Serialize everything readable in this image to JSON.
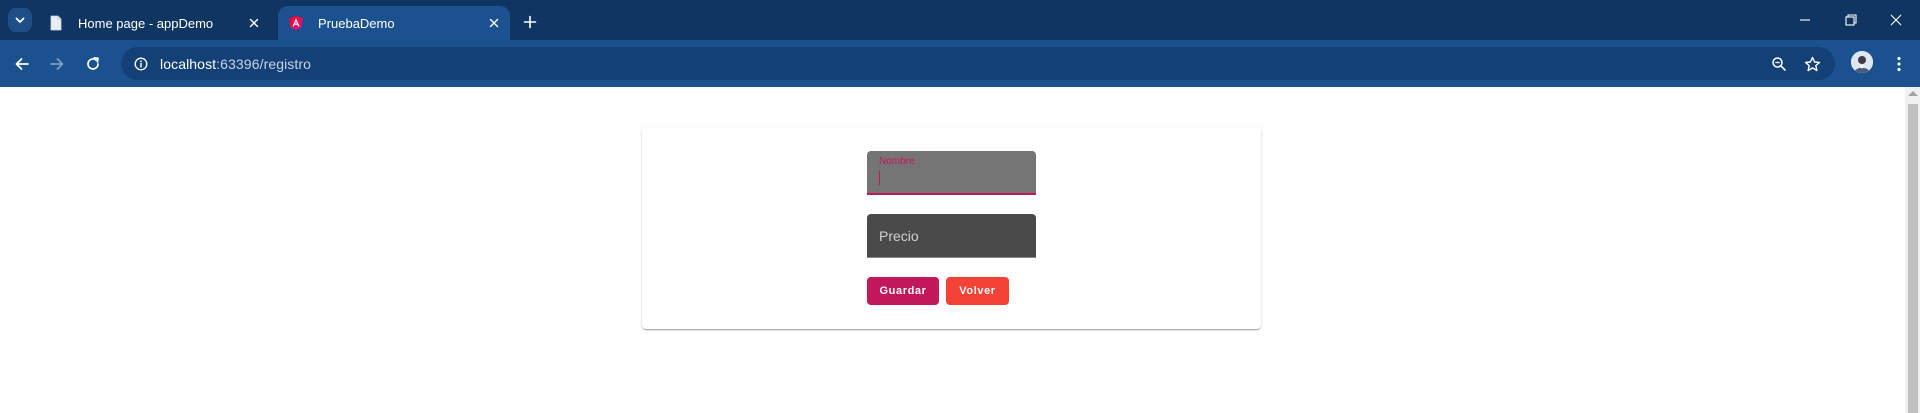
{
  "tabs": [
    {
      "title": "Home page - appDemo",
      "icon": "document-icon"
    },
    {
      "title": "PruebaDemo",
      "icon": "angular-icon"
    }
  ],
  "address_bar": {
    "host": "localhost",
    "path": ":63396/registro"
  },
  "form": {
    "nombre": {
      "label": "Nombre",
      "value": ""
    },
    "precio": {
      "placeholder": "Precio",
      "value": ""
    }
  },
  "buttons": {
    "guardar": "Guardar",
    "volver": "Volver"
  },
  "colors": {
    "primary": "#c2185b",
    "warn": "#f44336",
    "tabstrip": "#0f3562",
    "toolbar": "#1c5190"
  }
}
